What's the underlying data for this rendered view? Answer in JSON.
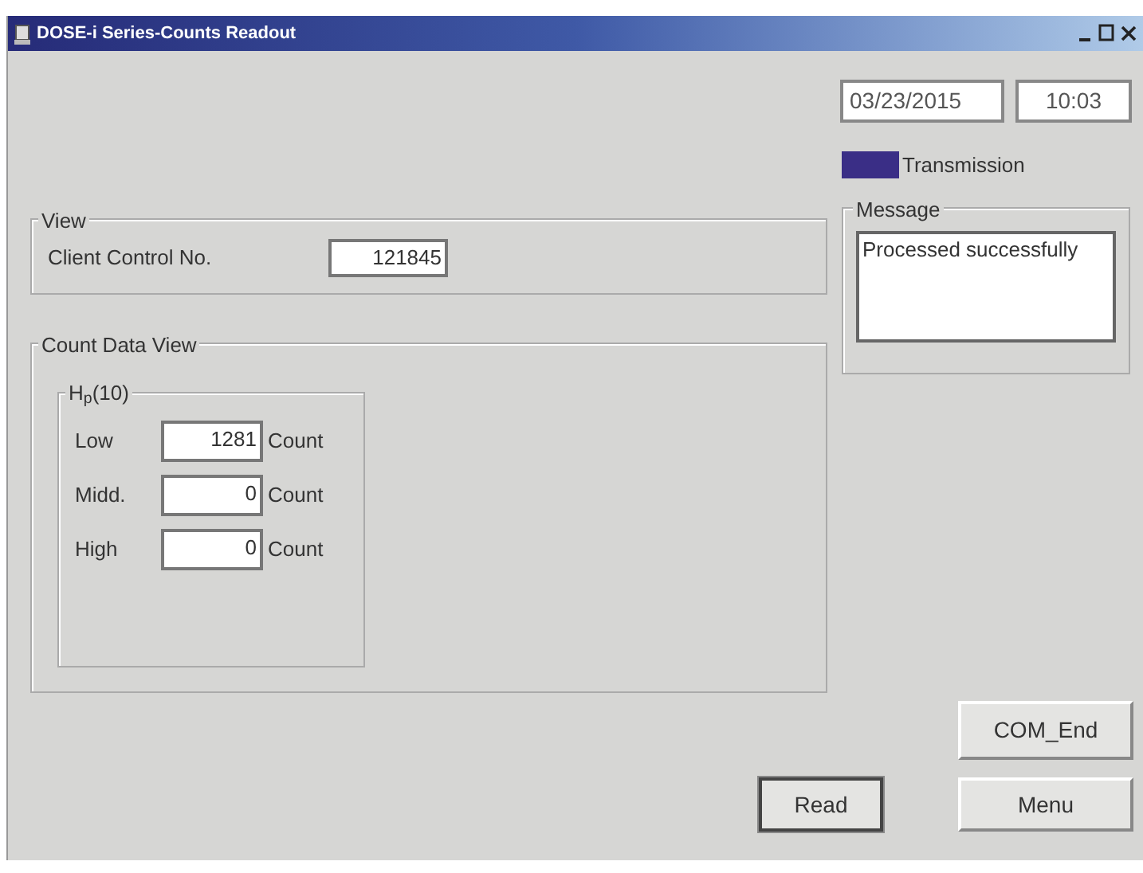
{
  "window": {
    "title": "DOSE-i Series-Counts Readout"
  },
  "date": "03/23/2015",
  "time": "10:03",
  "transmission": {
    "label": "Transmission",
    "on": true
  },
  "view": {
    "title": "View",
    "client_control_label": "Client Control No.",
    "client_control_value": "121845"
  },
  "count_data_view": {
    "title": "Count Data View",
    "group_title": "H$_{p}$(10)",
    "rows": [
      {
        "label": "Low",
        "value": "1281",
        "unit": "Count"
      },
      {
        "label": "Midd.",
        "value": "0",
        "unit": "Count"
      },
      {
        "label": "High",
        "value": "0",
        "unit": "Count"
      }
    ]
  },
  "message": {
    "title": "Message",
    "text": "Processed successfully"
  },
  "buttons": {
    "com_end": "COM_End",
    "read": "Read",
    "menu": "Menu"
  }
}
